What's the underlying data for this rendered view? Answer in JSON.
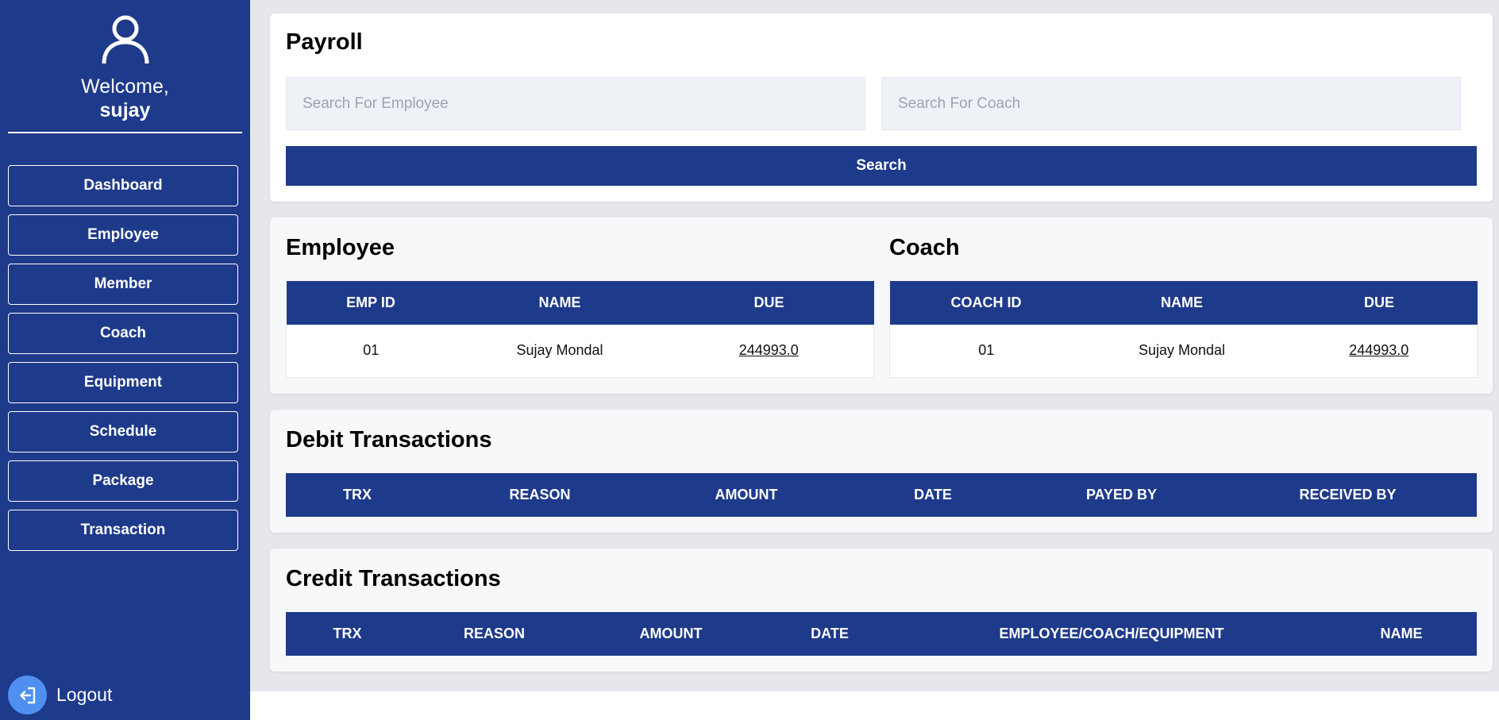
{
  "sidebar": {
    "welcome": "Welcome,",
    "username": "sujay",
    "nav": [
      "Dashboard",
      "Employee",
      "Member",
      "Coach",
      "Equipment",
      "Schedule",
      "Package",
      "Transaction"
    ],
    "logout": "Logout"
  },
  "payroll": {
    "title": "Payroll",
    "employee_placeholder": "Search For Employee",
    "coach_placeholder": "Search For Coach",
    "search_label": "Search"
  },
  "employee_section": {
    "title": "Employee",
    "headers": [
      "EMP ID",
      "NAME",
      "DUE"
    ],
    "row": {
      "id": "01",
      "name": "Sujay Mondal",
      "due": "244993.0"
    }
  },
  "coach_section": {
    "title": "Coach",
    "headers": [
      "COACH ID",
      "NAME",
      "DUE"
    ],
    "row": {
      "id": "01",
      "name": "Sujay Mondal",
      "due": "244993.0"
    }
  },
  "debit": {
    "title": "Debit Transactions",
    "headers": [
      "TRX",
      "REASON",
      "AMOUNT",
      "DATE",
      "PAYED BY",
      "RECEIVED BY"
    ]
  },
  "credit": {
    "title": "Credit Transactions",
    "headers": [
      "TRX",
      "REASON",
      "AMOUNT",
      "DATE",
      "EMPLOYEE/COACH/EQUIPMENT",
      "NAME"
    ]
  },
  "colors": {
    "primary": "#1e3a8a",
    "logout_icon_bg": "#4f8ff0",
    "page_bg": "#e5e7eb"
  },
  "icons": {
    "profile": "user-icon",
    "logout": "logout-icon"
  }
}
